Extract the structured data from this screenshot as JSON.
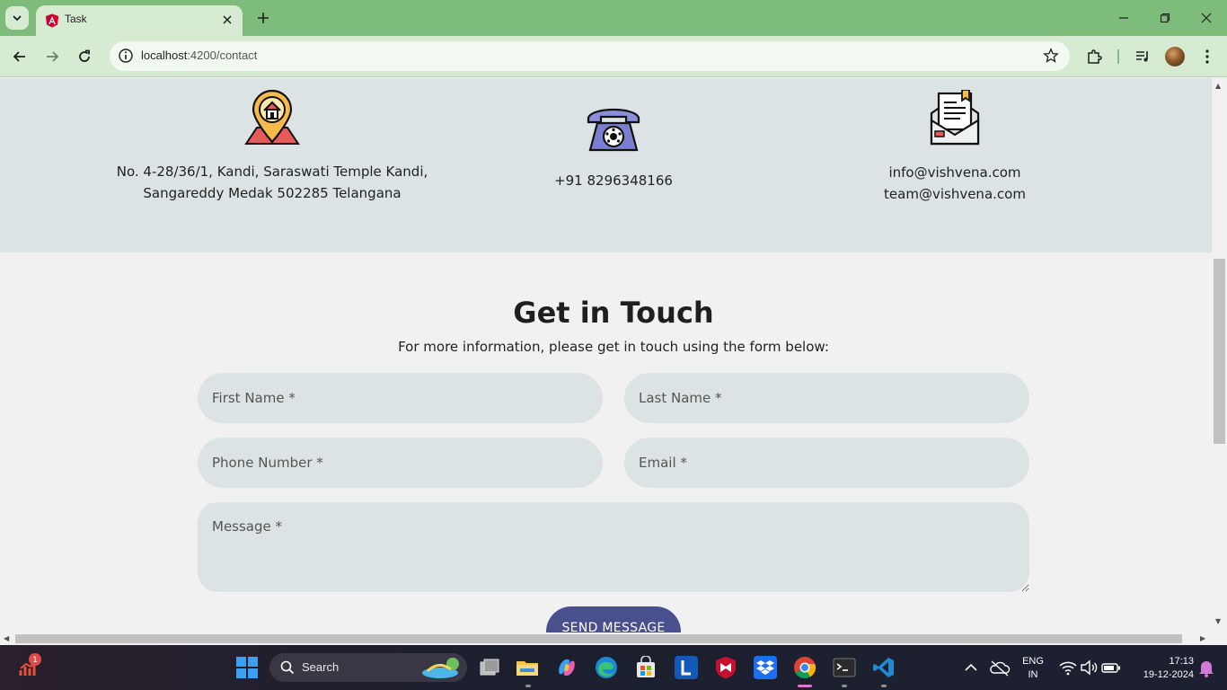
{
  "browser": {
    "tab_title": "Task",
    "url_host": "localhost",
    "url_path": ":4200/contact",
    "icons": [
      "tab-search-icon",
      "angular-favicon-icon",
      "close-icon",
      "plus-icon",
      "minimize-icon",
      "restore-icon",
      "close-window-icon",
      "back-icon",
      "forward-icon",
      "reload-icon",
      "site-info-icon",
      "star-icon",
      "extensions-icon",
      "media-icon",
      "profile-avatar",
      "kebab-menu-icon"
    ]
  },
  "contact_info": {
    "address_line1": "No. 4-28/36/1, Kandi, Saraswati Temple Kandi,",
    "address_line2": "Sangareddy Medak 502285 Telangana",
    "phone": "+91 8296348166",
    "email1": "info@vishvena.com",
    "email2": "team@vishvena.com"
  },
  "form": {
    "title": "Get in Touch",
    "subtitle": "For more information, please get in touch using the form below:",
    "first_name_placeholder": "First Name *",
    "last_name_placeholder": "Last Name *",
    "phone_placeholder": "Phone Number *",
    "email_placeholder": "Email *",
    "message_placeholder": "Message *",
    "send_label": "SEND MESSAGE"
  },
  "taskbar": {
    "search_label": "Search",
    "badge_count": "1",
    "lang_line1": "ENG",
    "lang_line2": "IN",
    "time": "17:13",
    "date": "19-12-2024",
    "accent": "#d37ad6"
  },
  "colors": {
    "chrome_green": "#7ebc7b",
    "toolbar_green": "#d7ebd3",
    "info_band": "#dce3e4",
    "button": "#4a4f8d"
  }
}
